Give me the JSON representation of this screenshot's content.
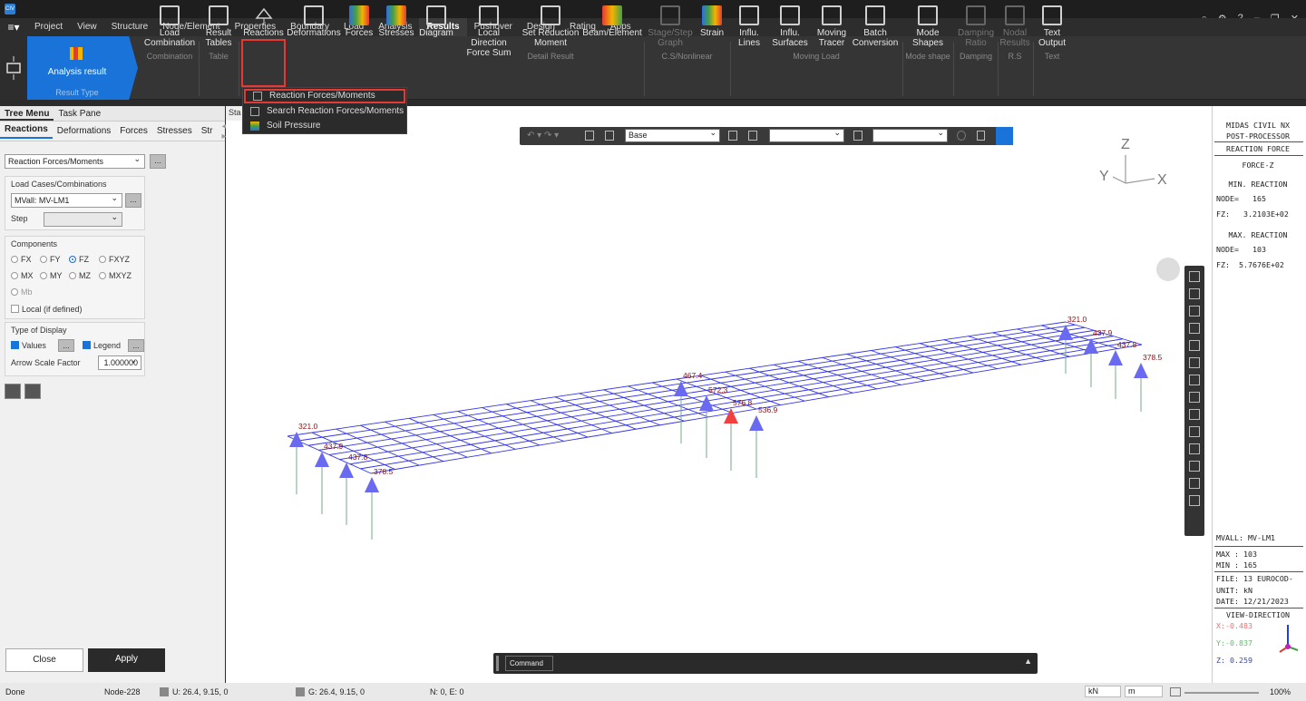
{
  "app": {
    "logo": "CIV"
  },
  "menu": [
    "Project",
    "View",
    "Structure",
    "Node/Element",
    "Properties",
    "Boundary",
    "Load",
    "Analysis",
    "Results",
    "Pushover",
    "Design",
    "Rating",
    "Apps"
  ],
  "menu_active": "Results",
  "ribbon": {
    "analysis_result": "Analysis result",
    "result_type": "Result Type",
    "load_combination": [
      "Load",
      "Combination"
    ],
    "combination_group": "Combination",
    "result_tables": [
      "Result",
      "Tables"
    ],
    "table_group": "Table",
    "reactions": "Reactions",
    "deformations": "Deformations",
    "forces": "Forces",
    "stresses": "Stresses",
    "diagram": "Diagram",
    "local_direction": [
      "Local Direction",
      "Force Sum"
    ],
    "set_reduction": [
      "Set Reduction",
      "Moment"
    ],
    "detail_result": "Detail Result",
    "beam_element": "Beam/Element",
    "stage_step": [
      "Stage/Step",
      "Graph"
    ],
    "strain": "Strain",
    "cs_group": "C.S/Nonlinear",
    "influ_lines": [
      "Influ.",
      "Lines"
    ],
    "influ_surfaces": [
      "Influ.",
      "Surfaces"
    ],
    "moving_tracer": [
      "Moving",
      "Tracer"
    ],
    "batch_conversion": [
      "Batch",
      "Conversion"
    ],
    "moving_load_group": "Moving Load",
    "mode_shapes": [
      "Mode",
      "Shapes"
    ],
    "mode_shape_group": "Mode shape",
    "damping_ratio": [
      "Damping",
      "Ratio"
    ],
    "damping_group": "Damping",
    "nodal_results": [
      "Nodal",
      "Results"
    ],
    "rs_group": "R.S",
    "text_output": [
      "Text",
      "Output"
    ],
    "text_group": "Text"
  },
  "dropdown": [
    "Reaction Forces/Moments",
    "Search Reaction Forces/Moments",
    "Soil Pressure"
  ],
  "left_panel": {
    "tabs": [
      "Tree Menu",
      "Task Pane"
    ],
    "subtabs": [
      "Reactions",
      "Deformations",
      "Forces",
      "Stresses",
      "Str"
    ],
    "type": "Reaction Forces/Moments",
    "load_cases_label": "Load Cases/Combinations",
    "load_case": "MVall: MV-LM1",
    "step_label": "Step",
    "components_label": "Components",
    "components": [
      "FX",
      "FY",
      "FZ",
      "FXYZ",
      "MX",
      "MY",
      "MZ",
      "MXYZ",
      "Mb"
    ],
    "selected_component": "FZ",
    "local_label": "Local (if defined)",
    "display_label": "Type of Display",
    "values_label": "Values",
    "legend_label": "Legend",
    "arrow_label": "Arrow Scale Factor",
    "arrow_value": "1.000000",
    "close": "Close",
    "apply": "Apply"
  },
  "view_tab": "Sta",
  "toolbar": {
    "base": "Base"
  },
  "model": {
    "axes": {
      "x": "X",
      "y": "Y",
      "z": "Z"
    },
    "labels": [
      "321.0",
      "437.9",
      "437.8",
      "378.5",
      "467.4",
      "572.3",
      "576.8",
      "536.9",
      "321.0",
      "437.9",
      "437.8",
      "378.5"
    ]
  },
  "legend": {
    "title": [
      "MIDAS CIVIL NX",
      "POST-PROCESSOR"
    ],
    "subtitle": "REACTION FORCE",
    "comp": "FORCE-Z",
    "min_label": "MIN. REACTION",
    "min_node": "NODE=   165",
    "min_fz": "FZ:   3.2103E+02",
    "max_label": "MAX. REACTION",
    "max_node": "NODE=   103",
    "max_fz": "FZ:  5.7676E+02",
    "mvall": "MVALL: MV-LM1",
    "max": "MAX : 103",
    "min": "MIN : 165",
    "file": "FILE: 13 EUROCOD-",
    "unit": "UNIT: kN",
    "date": "DATE: 12/21/2023",
    "viewdir": "VIEW-DIRECTION",
    "vx": "X:-0.483",
    "vy": "Y:-0.837",
    "vz": "Z: 0.259",
    "colors": {
      "x": "#e53935",
      "y": "#43a047",
      "z": "#1e40d9"
    }
  },
  "command": "Command",
  "status": {
    "done": "Done",
    "node": "Node-228",
    "u": "U: 26.4, 9.15, 0",
    "g": "G: 26.4, 9.15, 0",
    "ne": "N: 0, E: 0",
    "force_unit": "kN",
    "length_unit": "m",
    "zoom": "100%"
  }
}
